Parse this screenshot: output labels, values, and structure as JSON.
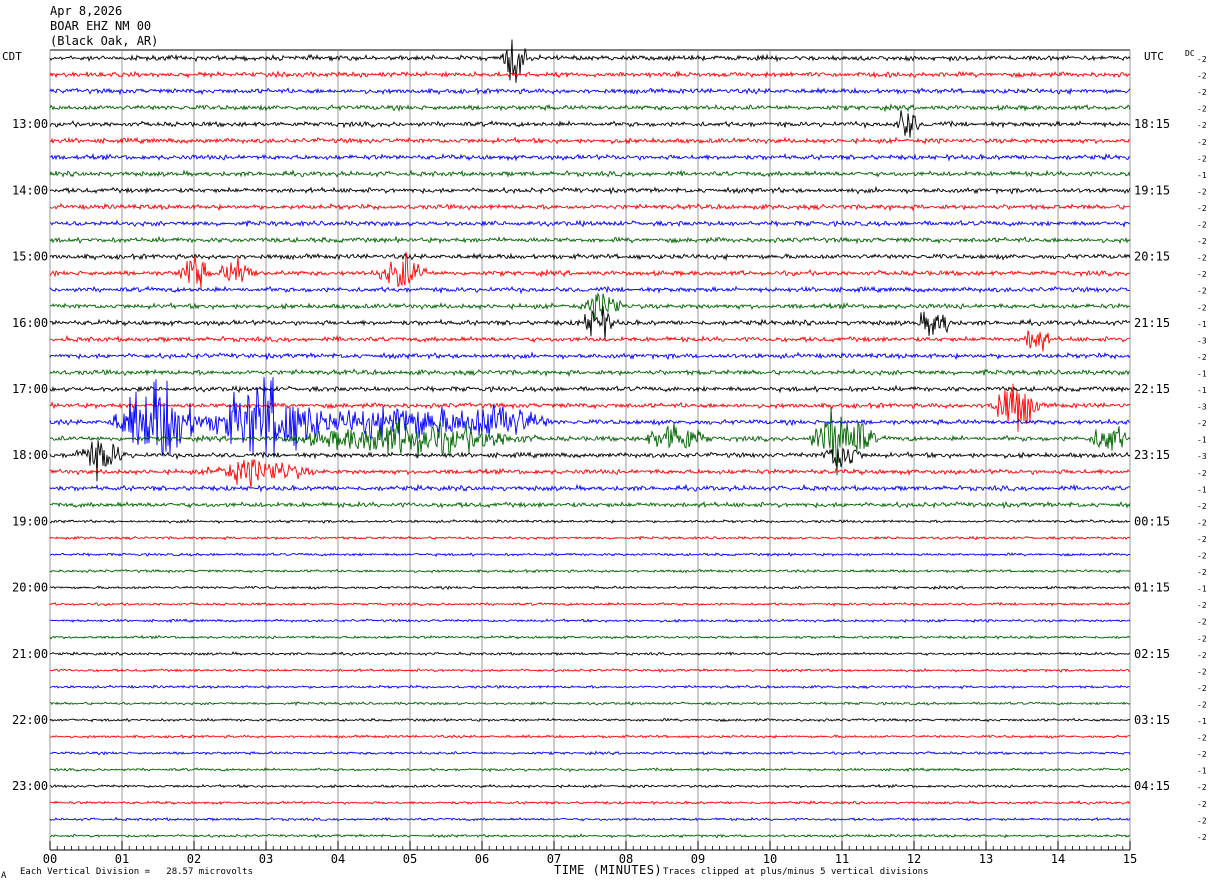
{
  "header": {
    "date": "Apr 8,2026",
    "station": "BOAR EHZ NM 00",
    "location": "(Black Oak, AR)"
  },
  "left_tz": "CDT",
  "right_tz": "UTC",
  "dc_label": "DC",
  "footer": {
    "scale_text": "Each Vertical Division =   28.57 microvolts",
    "x_title": "TIME (MINUTES)",
    "clip_text": "Traces clipped at plus/minus 5 vertical divisions",
    "corner_mark": "A"
  },
  "colors": {
    "trace_cycle": [
      "#000000",
      "#ff0000",
      "#0000ff",
      "#006400"
    ],
    "grid": "#808080",
    "background": "#ffffff"
  },
  "chart_data": {
    "type": "line",
    "title": "BOAR EHZ NM 00",
    "x_axis": {
      "label": "TIME (MINUTES)",
      "range": [
        0,
        15
      ],
      "ticks": [
        "00",
        "01",
        "02",
        "03",
        "04",
        "05",
        "06",
        "07",
        "08",
        "09",
        "10",
        "11",
        "12",
        "13",
        "14",
        "15"
      ]
    },
    "left_hour_labels": [
      {
        "row": 4,
        "label": "13:00"
      },
      {
        "row": 8,
        "label": "14:00"
      },
      {
        "row": 12,
        "label": "15:00"
      },
      {
        "row": 16,
        "label": "16:00"
      },
      {
        "row": 20,
        "label": "17:00"
      },
      {
        "row": 24,
        "label": "18:00"
      },
      {
        "row": 28,
        "label": "19:00"
      },
      {
        "row": 32,
        "label": "20:00"
      },
      {
        "row": 36,
        "label": "21:00"
      },
      {
        "row": 40,
        "label": "22:00"
      },
      {
        "row": 44,
        "label": "23:00"
      }
    ],
    "right_hour_labels": [
      {
        "row": 4,
        "label": "18:15"
      },
      {
        "row": 8,
        "label": "19:15"
      },
      {
        "row": 12,
        "label": "20:15"
      },
      {
        "row": 16,
        "label": "21:15"
      },
      {
        "row": 20,
        "label": "22:15"
      },
      {
        "row": 24,
        "label": "23:15"
      },
      {
        "row": 28,
        "label": "00:15"
      },
      {
        "row": 32,
        "label": "01:15"
      },
      {
        "row": 36,
        "label": "02:15"
      },
      {
        "row": 40,
        "label": "03:15"
      },
      {
        "row": 44,
        "label": "04:15"
      }
    ],
    "dc_offsets": [
      -2,
      -2,
      -2,
      -2,
      -2,
      -2,
      -2,
      -1,
      -2,
      -2,
      -2,
      -2,
      -2,
      -2,
      -2,
      -2,
      -1,
      -3,
      -2,
      -1,
      -1,
      -3,
      -2,
      -1,
      -3,
      -2,
      -1,
      -2,
      -2,
      -2,
      -2,
      -2,
      -1,
      -2,
      -2,
      -2,
      -2,
      -2,
      -2,
      -2,
      -1,
      -2,
      -2,
      -1,
      -2,
      -2,
      -2,
      -2
    ],
    "trace_count": 48,
    "events": [
      {
        "row": 0,
        "t": 6.45,
        "amp": 3.5,
        "dur": 0.2
      },
      {
        "row": 4,
        "t": 11.9,
        "amp": 2.0,
        "dur": 0.2
      },
      {
        "row": 13,
        "t": 2.0,
        "amp": 2.2,
        "dur": 0.25
      },
      {
        "row": 13,
        "t": 2.6,
        "amp": 1.6,
        "dur": 0.3
      },
      {
        "row": 13,
        "t": 4.9,
        "amp": 2.0,
        "dur": 0.4
      },
      {
        "row": 15,
        "t": 7.7,
        "amp": 2.0,
        "dur": 0.3
      },
      {
        "row": 16,
        "t": 7.6,
        "amp": 2.0,
        "dur": 0.3
      },
      {
        "row": 16,
        "t": 12.3,
        "amp": 1.8,
        "dur": 0.3
      },
      {
        "row": 17,
        "t": 13.7,
        "amp": 2.0,
        "dur": 0.2
      },
      {
        "row": 21,
        "t": 13.4,
        "amp": 3.0,
        "dur": 0.4
      },
      {
        "row": 22,
        "t": 1.5,
        "amp": 5.0,
        "dur": 0.7
      },
      {
        "row": 22,
        "t": 3.0,
        "amp": 5.0,
        "dur": 0.9
      },
      {
        "row": 22,
        "t": 4.9,
        "amp": 2.0,
        "dur": 1.6
      },
      {
        "row": 22,
        "t": 6.3,
        "amp": 2.0,
        "dur": 0.7
      },
      {
        "row": 23,
        "t": 5.0,
        "amp": 2.0,
        "dur": 1.8
      },
      {
        "row": 23,
        "t": 8.7,
        "amp": 2.0,
        "dur": 0.5
      },
      {
        "row": 23,
        "t": 11.0,
        "amp": 4.0,
        "dur": 0.5
      },
      {
        "row": 23,
        "t": 14.7,
        "amp": 2.0,
        "dur": 0.3
      },
      {
        "row": 24,
        "t": 0.7,
        "amp": 2.0,
        "dur": 0.4
      },
      {
        "row": 24,
        "t": 11.0,
        "amp": 2.0,
        "dur": 0.3
      },
      {
        "row": 25,
        "t": 2.9,
        "amp": 1.5,
        "dur": 0.8
      }
    ]
  }
}
